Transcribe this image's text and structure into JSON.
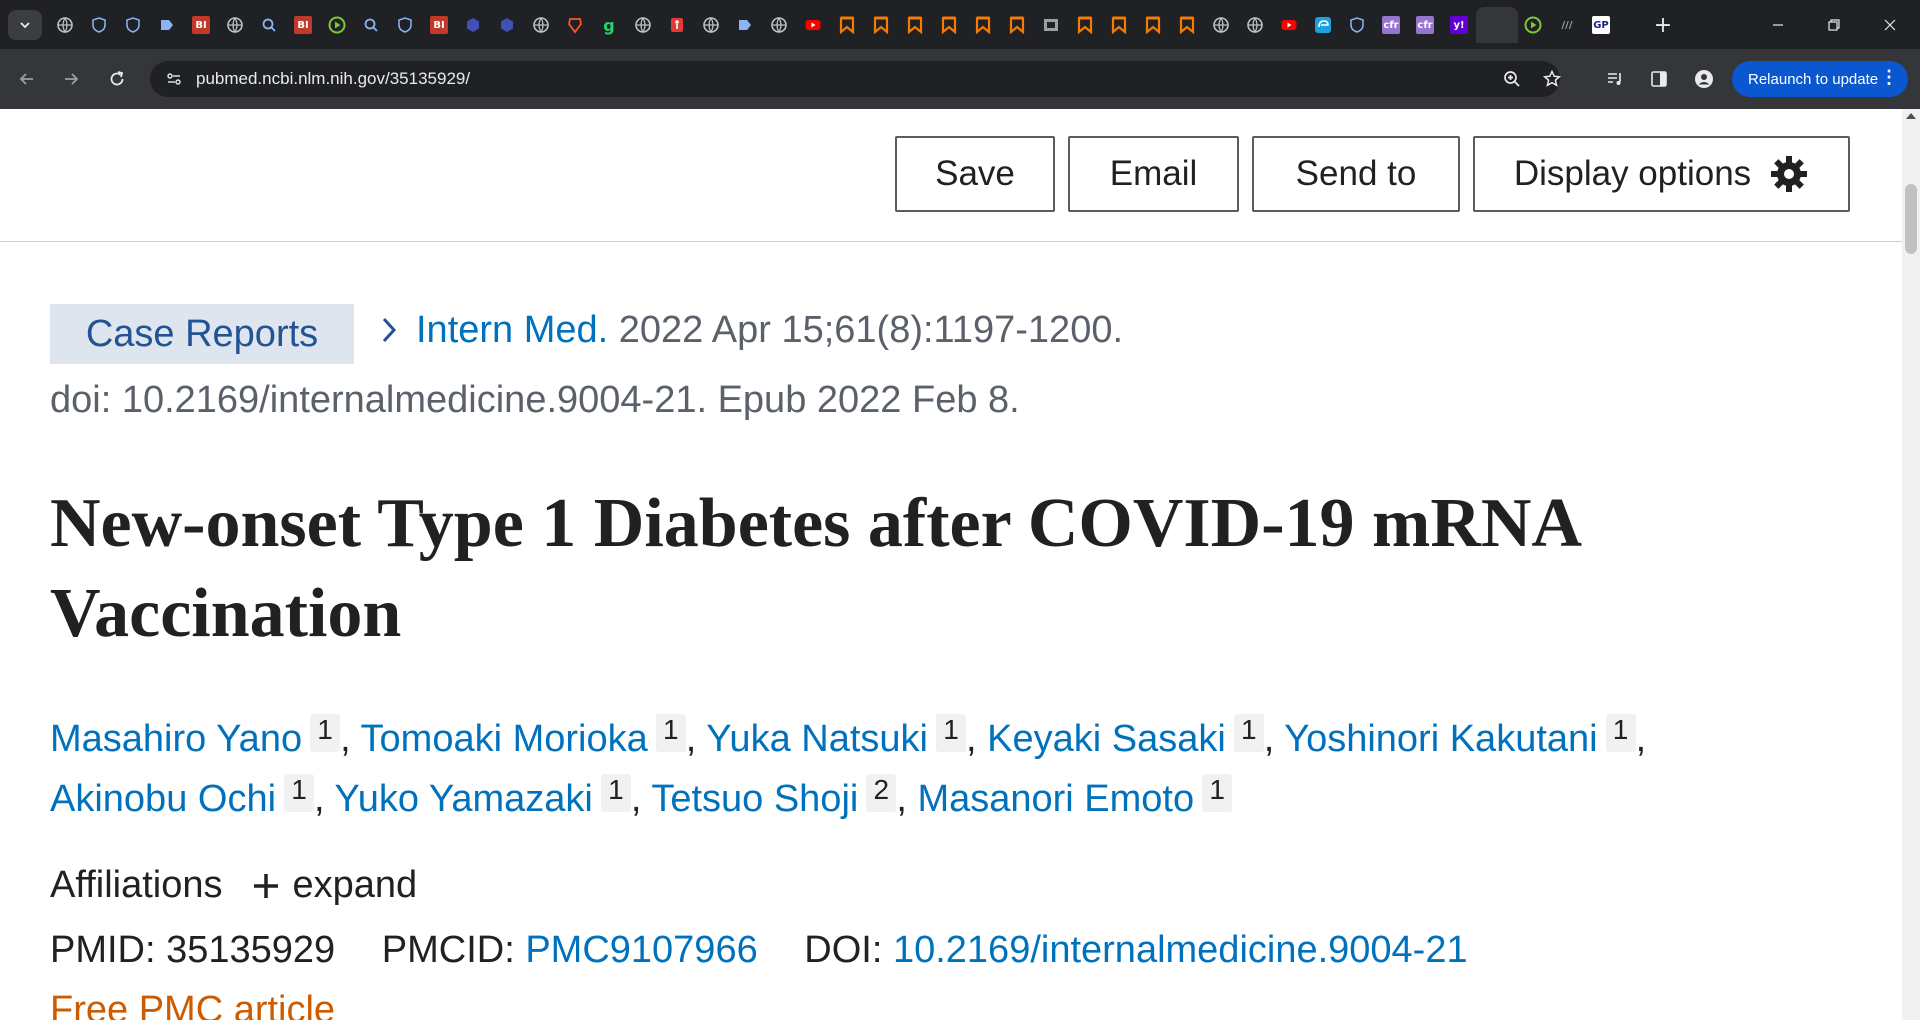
{
  "browser": {
    "tabs": [
      {
        "icon": "globe-icon",
        "color": "#bdc1c6"
      },
      {
        "icon": "shield-heart-icon",
        "color": "#8ab4f8"
      },
      {
        "icon": "shield-heart-icon",
        "color": "#8ab4f8"
      },
      {
        "icon": "arrow-tag-icon",
        "color": "#8ab4f8"
      },
      {
        "icon": "bi-logo-icon",
        "color": "#c0392b",
        "glyph": "BI"
      },
      {
        "icon": "globe-icon",
        "color": "#bdc1c6"
      },
      {
        "icon": "magnifier-icon",
        "color": "#8ab4f8"
      },
      {
        "icon": "bi-logo-icon",
        "color": "#c0392b",
        "glyph": "BI"
      },
      {
        "icon": "play-circle-icon",
        "color": "#7cc836"
      },
      {
        "icon": "magnifier-icon",
        "color": "#8ab4f8"
      },
      {
        "icon": "shield-heart-icon",
        "color": "#8ab4f8"
      },
      {
        "icon": "bi-logo-icon",
        "color": "#c0392b",
        "glyph": "BI"
      },
      {
        "icon": "cube-icon",
        "color": "#3f51b5"
      },
      {
        "icon": "cube-icon",
        "color": "#3f51b5"
      },
      {
        "icon": "globe-icon",
        "color": "#bdc1c6"
      },
      {
        "icon": "brave-shield-icon",
        "color": "#fb542b"
      },
      {
        "icon": "g-logo-icon",
        "color": "#25d366",
        "glyph": "g"
      },
      {
        "icon": "globe-icon",
        "color": "#bdc1c6"
      },
      {
        "icon": "red-figure-icon",
        "color": "#e53935"
      },
      {
        "icon": "globe-icon",
        "color": "#bdc1c6"
      },
      {
        "icon": "arrow-tag-icon",
        "color": "#8ab4f8"
      },
      {
        "icon": "globe-icon",
        "color": "#bdc1c6"
      },
      {
        "icon": "youtube-icon",
        "color": "#ff0000"
      },
      {
        "icon": "bookmark-ribbon-icon",
        "color": "#f57c00"
      },
      {
        "icon": "bookmark-ribbon-icon",
        "color": "#f57c00"
      },
      {
        "icon": "bookmark-ribbon-icon",
        "color": "#f57c00"
      },
      {
        "icon": "bookmark-ribbon-icon",
        "color": "#f57c00"
      },
      {
        "icon": "bookmark-ribbon-icon",
        "color": "#f57c00"
      },
      {
        "icon": "bookmark-ribbon-icon",
        "color": "#f57c00"
      },
      {
        "icon": "film-strip-icon",
        "color": "#9aa0a6"
      },
      {
        "icon": "bookmark-ribbon-icon",
        "color": "#f57c00"
      },
      {
        "icon": "bookmark-ribbon-icon",
        "color": "#f57c00"
      },
      {
        "icon": "bookmark-ribbon-icon",
        "color": "#f57c00"
      },
      {
        "icon": "bookmark-ribbon-icon",
        "color": "#f57c00"
      },
      {
        "icon": "globe-icon",
        "color": "#bdc1c6"
      },
      {
        "icon": "globe-icon",
        "color": "#bdc1c6"
      },
      {
        "icon": "youtube-icon",
        "color": "#ff0000"
      },
      {
        "icon": "edge-logo-icon",
        "color": "#1ba1e2"
      },
      {
        "icon": "shield-heart-icon",
        "color": "#8ab4f8"
      },
      {
        "icon": "cfr-logo-icon",
        "color": "#9575cd",
        "glyph": "cfr"
      },
      {
        "icon": "cfr-logo-icon",
        "color": "#9575cd",
        "glyph": "cfr"
      },
      {
        "icon": "yahoo-icon",
        "color": "#6001d2",
        "glyph": "y!"
      },
      {
        "icon": "close-icon",
        "color": "#e8eaed",
        "active": true
      },
      {
        "icon": "play-circle-icon",
        "color": "#7cc836"
      },
      {
        "icon": "hatch-icon",
        "color": "#9aa0a6",
        "glyph": "///"
      },
      {
        "icon": "gp-logo-icon",
        "color": "#1a237e",
        "glyph": "GP"
      }
    ],
    "new_tab_label": "+",
    "url": "pubmed.ncbi.nlm.nih.gov/35135929/",
    "relaunch_label": "Relaunch to update"
  },
  "actions": {
    "save": "Save",
    "email": "Email",
    "send_to": "Send to",
    "display_options": "Display options"
  },
  "article": {
    "publication_type": "Case Reports",
    "journal": "Intern Med.",
    "citation_rest": " 2022 Apr 15;61(8):1197-1200.",
    "doi_line": "doi: 10.2169/internalmedicine.9004-21. Epub 2022 Feb 8.",
    "title": "New-onset Type 1 Diabetes after COVID-19 mRNA Vaccination",
    "authors": [
      {
        "name": "Masahiro Yano",
        "aff": "1"
      },
      {
        "name": "Tomoaki Morioka",
        "aff": "1"
      },
      {
        "name": "Yuka Natsuki",
        "aff": "1"
      },
      {
        "name": "Keyaki Sasaki",
        "aff": "1"
      },
      {
        "name": "Yoshinori Kakutani",
        "aff": "1"
      },
      {
        "name": "Akinobu Ochi",
        "aff": "1"
      },
      {
        "name": "Yuko Yamazaki",
        "aff": "1"
      },
      {
        "name": "Tetsuo Shoji",
        "aff": "2"
      },
      {
        "name": "Masanori Emoto",
        "aff": "1"
      }
    ],
    "affiliations_label": "Affiliations",
    "expand_label": "expand",
    "pmid_label": "PMID:",
    "pmid": "35135929",
    "pmcid_label": "PMCID:",
    "pmcid": "PMC9107966",
    "doi_label": "DOI:",
    "doi": "10.2169/internalmedicine.9004-21",
    "free_pmc": "Free PMC article"
  }
}
